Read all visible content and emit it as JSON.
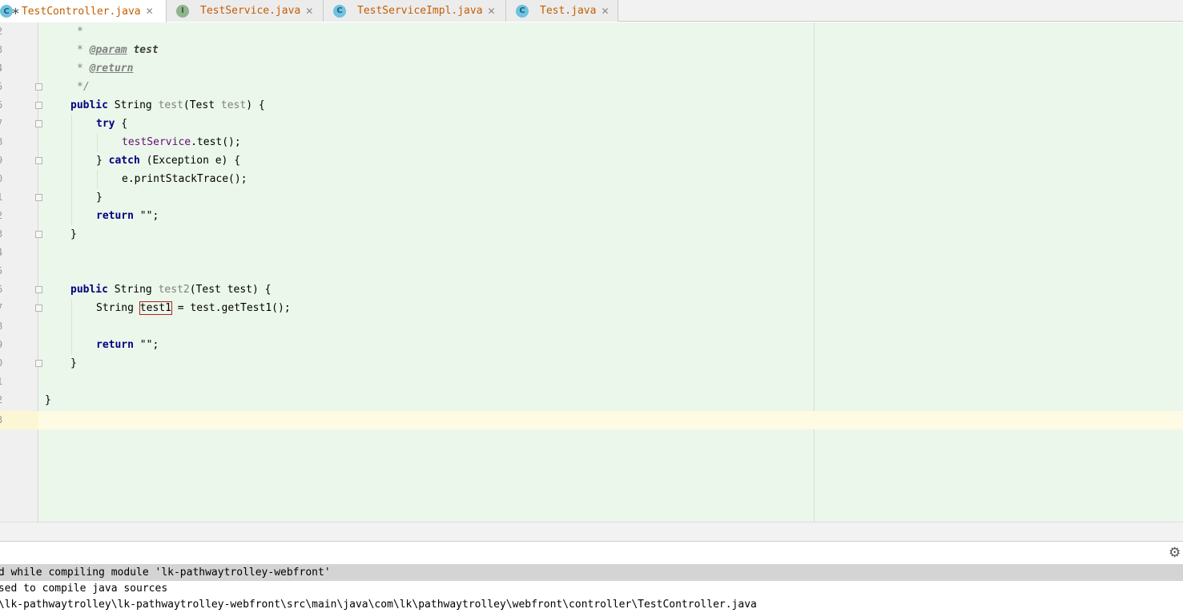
{
  "tabs": [
    {
      "label": "TestController.java",
      "icon": "C",
      "icon_kind": "class",
      "active": true,
      "modified": true
    },
    {
      "label": "TestService.java",
      "icon": "I",
      "icon_kind": "interface",
      "active": false,
      "modified": false
    },
    {
      "label": "TestServiceImpl.java",
      "icon": "C",
      "icon_kind": "class",
      "active": false,
      "modified": false
    },
    {
      "label": "Test.java",
      "icon": "C",
      "icon_kind": "class",
      "active": false,
      "modified": false
    }
  ],
  "editor": {
    "line_numbers": [
      "2",
      "3",
      "4",
      "5",
      "6",
      "7",
      "8",
      "9",
      "0",
      "1",
      "2",
      "3",
      "4",
      "5",
      "6",
      "7",
      "8",
      "9",
      "0",
      "1",
      "2",
      "3"
    ],
    "code": {
      "l0_star": "*",
      "l1_star": "*",
      "l1_tag": "@param",
      "l1_name": "test",
      "l2_star": "*",
      "l2_tag": "@return",
      "l3_end": "*/",
      "l4_kw": "public",
      "l4_type": "String",
      "l4_name": "test",
      "l4_open": "(Test",
      "l4_param": "test",
      "l4_close": ") {",
      "l5_kw": "try",
      "l5_rest": " {",
      "l6_field": "testService",
      "l6_rest": ".test();",
      "l7_open": "} ",
      "l7_kw": "catch",
      "l7_rest": " (Exception e) {",
      "l8_rest": "e.printStackTrace();",
      "l9_rest": "}",
      "l10_kw": "return",
      "l10_rest": " \"\";",
      "l11_rest": "}",
      "l14_kw": "public",
      "l14_type": "String",
      "l14_name": "test2",
      "l14_rest": "(Test test) {",
      "l15_type": "String",
      "l15_var": "test1",
      "l15_rest": " = test.getTest1();",
      "l17_kw": "return",
      "l17_rest": " \"\";",
      "l18_rest": "}",
      "l20_rest": "}"
    }
  },
  "messages": {
    "line1": "ed while compiling module 'lk-pathwaytrolley-webfront'",
    "line2": "used to compile java sources",
    "line3": "t\\lk-pathwaytrolley\\lk-pathwaytrolley-webfront\\src\\main\\java\\com\\lk\\pathwaytrolley\\webfront\\controller\\TestController.java"
  }
}
